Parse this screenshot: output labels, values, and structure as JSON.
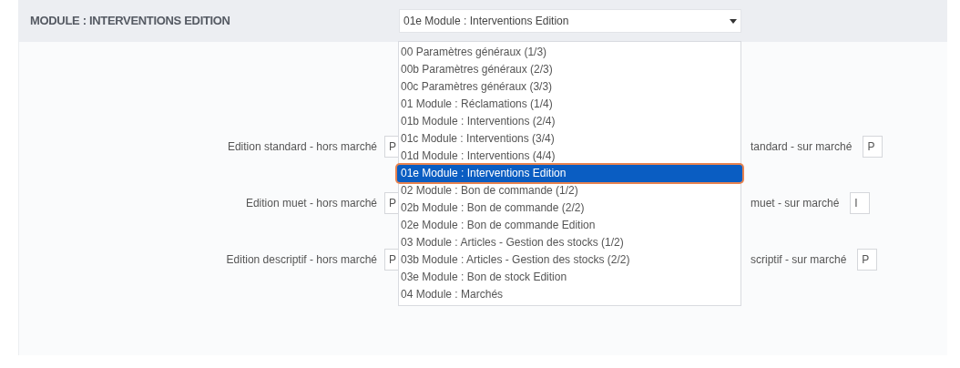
{
  "header": {
    "title": "MODULE : INTERVENTIONS EDITION"
  },
  "select": {
    "value": "01e  Module : Interventions Edition",
    "expanded": true,
    "options": [
      {
        "label": "00  Paramètres généraux (1/3)",
        "selected": false
      },
      {
        "label": "00b  Paramètres généraux (2/3)",
        "selected": false
      },
      {
        "label": "00c  Paramètres généraux (3/3)",
        "selected": false
      },
      {
        "label": "01  Module : Réclamations (1/4)",
        "selected": false
      },
      {
        "label": "01b  Module : Interventions (2/4)",
        "selected": false
      },
      {
        "label": "01c  Module : Interventions (3/4)",
        "selected": false
      },
      {
        "label": "01d  Module : Interventions (4/4)",
        "selected": false
      },
      {
        "label": "01e  Module : Interventions Edition",
        "selected": true
      },
      {
        "label": "02  Module : Bon de commande (1/2)",
        "selected": false
      },
      {
        "label": "02b  Module : Bon de commande (2/2)",
        "selected": false
      },
      {
        "label": "02e  Module : Bon de commande Edition",
        "selected": false
      },
      {
        "label": "03  Module : Articles - Gestion des stocks (1/2)",
        "selected": false
      },
      {
        "label": "03b  Module : Articles - Gestion des stocks (2/2)",
        "selected": false
      },
      {
        "label": "03e  Module : Bon de stock Edition",
        "selected": false
      },
      {
        "label": "04  Module : Marchés",
        "selected": false
      }
    ]
  },
  "rows": [
    {
      "left": {
        "label": "Edition standard - hors marché",
        "value": "P"
      },
      "right": {
        "label": "tandard - sur marché",
        "value": "P"
      }
    },
    {
      "left": {
        "label": "Edition muet - hors marché",
        "value": "P"
      },
      "right": {
        "label": "muet - sur marché",
        "value": "I"
      }
    },
    {
      "left": {
        "label": "Edition descriptif - hors marché",
        "value": "P"
      },
      "right": {
        "label": "scriptif - sur marché",
        "value": "P"
      }
    }
  ]
}
